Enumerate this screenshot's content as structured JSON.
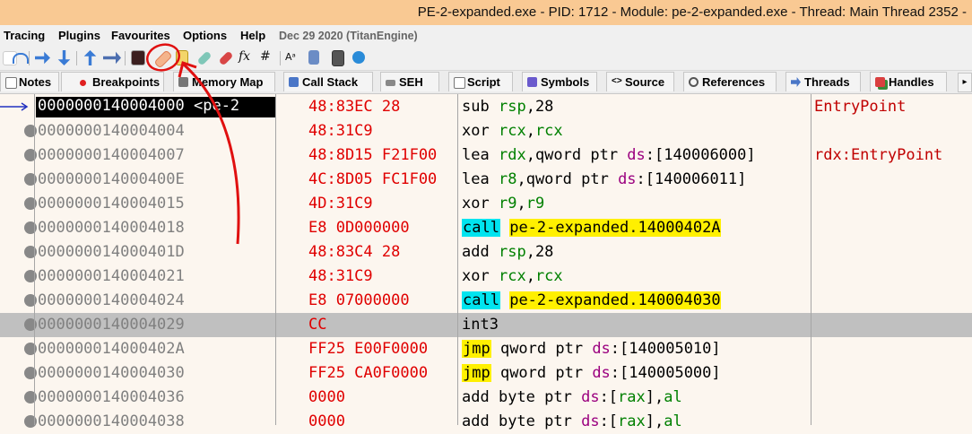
{
  "window": {
    "title": "PE-2-expanded.exe - PID: 1712 - Module: pe-2-expanded.exe - Thread: Main Thread 2352 -"
  },
  "menu": {
    "items": [
      "Tracing",
      "Plugins",
      "Favourites",
      "Options",
      "Help"
    ],
    "date": "Dec 29 2020 (TitanEngine)"
  },
  "toolbar": {
    "icons": [
      "step-into-icon",
      "step-over-icon",
      "run-to-user-icon",
      "execute-till-return-icon",
      "animate-icon",
      "trace-icon",
      "cpu-icon",
      "patch-icon",
      "comment-icon",
      "label-icon",
      "bookmark-icon",
      "function-icon",
      "hash-icon",
      "font-icon",
      "module-icon",
      "calculator-icon",
      "web-icon"
    ]
  },
  "tabs": [
    {
      "label": "Notes",
      "icon": "notes-icon"
    },
    {
      "label": "Breakpoints",
      "icon": "breakpoint-icon"
    },
    {
      "label": "Memory Map",
      "icon": "memory-icon"
    },
    {
      "label": "Call Stack",
      "icon": "callstack-icon"
    },
    {
      "label": "SEH",
      "icon": "seh-icon"
    },
    {
      "label": "Script",
      "icon": "script-icon"
    },
    {
      "label": "Symbols",
      "icon": "symbols-icon"
    },
    {
      "label": "Source",
      "icon": "source-icon"
    },
    {
      "label": "References",
      "icon": "references-icon"
    },
    {
      "label": "Threads",
      "icon": "threads-icon"
    },
    {
      "label": "Handles",
      "icon": "handles-icon"
    }
  ],
  "tabs_more": "▸",
  "colors": {
    "title_bg": "#f9c993",
    "address_fg": "#808080",
    "bytes_fg": "#e00000",
    "call_highlight": "#00e4ef",
    "jump_highlight": "#fff000",
    "selected_row": "#c0c0c0",
    "annotation": "#e01010"
  },
  "disasm": [
    {
      "addr": "0000000140004000 <pe-2",
      "bytes": "48:83EC 28",
      "parts": [
        [
          "mn",
          "sub"
        ],
        [
          "t",
          " "
        ],
        [
          "reg",
          "rsp"
        ],
        [
          "t",
          ","
        ],
        [
          "num",
          "28"
        ]
      ],
      "comment": "EntryPoint",
      "current": true
    },
    {
      "addr": "0000000140004004",
      "bytes": "48:31C9",
      "parts": [
        [
          "mn",
          "xor"
        ],
        [
          "t",
          " "
        ],
        [
          "reg",
          "rcx"
        ],
        [
          "t",
          ","
        ],
        [
          "reg",
          "rcx"
        ]
      ],
      "comment": ""
    },
    {
      "addr": "0000000140004007",
      "bytes": "48:8D15 F21F00",
      "parts": [
        [
          "mn",
          "lea"
        ],
        [
          "t",
          " "
        ],
        [
          "reg",
          "rdx"
        ],
        [
          "t",
          ","
        ],
        [
          "t",
          "qword ptr "
        ],
        [
          "kw",
          "ds"
        ],
        [
          "t",
          ":["
        ],
        [
          "num",
          "140006000"
        ],
        [
          "t",
          "]"
        ]
      ],
      "comment": "rdx:EntryPoint"
    },
    {
      "addr": "000000014000400E",
      "bytes": "4C:8D05 FC1F00",
      "parts": [
        [
          "mn",
          "lea"
        ],
        [
          "t",
          " "
        ],
        [
          "reg",
          "r8"
        ],
        [
          "t",
          ","
        ],
        [
          "t",
          "qword ptr "
        ],
        [
          "kw",
          "ds"
        ],
        [
          "t",
          ":["
        ],
        [
          "num",
          "140006011"
        ],
        [
          "t",
          "]"
        ]
      ],
      "comment": ""
    },
    {
      "addr": "0000000140004015",
      "bytes": "4D:31C9",
      "parts": [
        [
          "mn",
          "xor"
        ],
        [
          "t",
          " "
        ],
        [
          "reg",
          "r9"
        ],
        [
          "t",
          ","
        ],
        [
          "reg",
          "r9"
        ]
      ],
      "comment": ""
    },
    {
      "addr": "0000000140004018",
      "bytes": "E8 0D000000",
      "parts": [
        [
          "call",
          "call"
        ],
        [
          "t",
          " "
        ],
        [
          "target",
          "pe-2-expanded.14000402A"
        ]
      ],
      "comment": ""
    },
    {
      "addr": "000000014000401D",
      "bytes": "48:83C4 28",
      "parts": [
        [
          "mn",
          "add"
        ],
        [
          "t",
          " "
        ],
        [
          "reg",
          "rsp"
        ],
        [
          "t",
          ","
        ],
        [
          "num",
          "28"
        ]
      ],
      "comment": ""
    },
    {
      "addr": "0000000140004021",
      "bytes": "48:31C9",
      "parts": [
        [
          "mn",
          "xor"
        ],
        [
          "t",
          " "
        ],
        [
          "reg",
          "rcx"
        ],
        [
          "t",
          ","
        ],
        [
          "reg",
          "rcx"
        ]
      ],
      "comment": ""
    },
    {
      "addr": "0000000140004024",
      "bytes": "E8 07000000",
      "parts": [
        [
          "call",
          "call"
        ],
        [
          "t",
          " "
        ],
        [
          "target",
          "pe-2-expanded.140004030"
        ]
      ],
      "comment": ""
    },
    {
      "addr": "0000000140004029",
      "bytes": "CC",
      "parts": [
        [
          "mn",
          "int3"
        ]
      ],
      "comment": "",
      "selected": true
    },
    {
      "addr": "000000014000402A",
      "bytes": "FF25 E00F0000",
      "parts": [
        [
          "jmp",
          "jmp"
        ],
        [
          "t",
          " qword ptr "
        ],
        [
          "kw",
          "ds"
        ],
        [
          "t",
          ":["
        ],
        [
          "num",
          "140005010"
        ],
        [
          "t",
          "]"
        ]
      ],
      "comment": ""
    },
    {
      "addr": "0000000140004030",
      "bytes": "FF25 CA0F0000",
      "parts": [
        [
          "jmp",
          "jmp"
        ],
        [
          "t",
          " qword ptr "
        ],
        [
          "kw",
          "ds"
        ],
        [
          "t",
          ":["
        ],
        [
          "num",
          "140005000"
        ],
        [
          "t",
          "]"
        ]
      ],
      "comment": ""
    },
    {
      "addr": "0000000140004036",
      "bytes": "0000",
      "parts": [
        [
          "mn",
          "add"
        ],
        [
          "t",
          " byte ptr "
        ],
        [
          "kw",
          "ds"
        ],
        [
          "t",
          ":["
        ],
        [
          "reg",
          "rax"
        ],
        [
          "t",
          "],"
        ],
        [
          "reg",
          "al"
        ]
      ],
      "comment": ""
    },
    {
      "addr": "0000000140004038",
      "bytes": "0000",
      "parts": [
        [
          "mn",
          "add"
        ],
        [
          "t",
          " byte ptr "
        ],
        [
          "kw",
          "ds"
        ],
        [
          "t",
          ":["
        ],
        [
          "reg",
          "rax"
        ],
        [
          "t",
          "],"
        ],
        [
          "reg",
          "al"
        ]
      ],
      "comment": ""
    }
  ]
}
